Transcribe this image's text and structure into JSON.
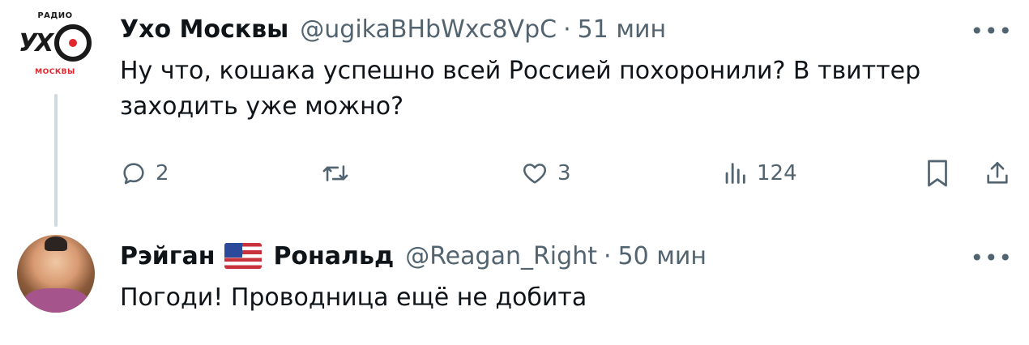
{
  "tweets": [
    {
      "author": "Ухо Москвы",
      "handle": "@ugikaBHbWxc8VpC",
      "separator": "·",
      "time": "51 мин",
      "text": "Ну что, кошака успешно всей Россией похоронили? В твиттер заходить уже можно?",
      "avatar_logo": {
        "top": "РАДИО",
        "main": "УХ",
        "bottom": "МОСКВЫ"
      },
      "more_icon": "more-dots-icon",
      "actions": {
        "replies": "2",
        "retweets": "",
        "likes": "3",
        "views": "124"
      }
    },
    {
      "author_first": "Рэйган",
      "author_second": "Рональд",
      "flag_icon": "us-flag-icon",
      "handle": "@Reagan_Right",
      "separator": "·",
      "time": "50 мин",
      "text": "Погоди! Проводница ещё не добита",
      "more_icon": "more-dots-icon"
    }
  ],
  "colors": {
    "text": "#0f1419",
    "muted": "#536471",
    "thread_line": "#cfd9de",
    "logo_red": "#e0282e"
  }
}
